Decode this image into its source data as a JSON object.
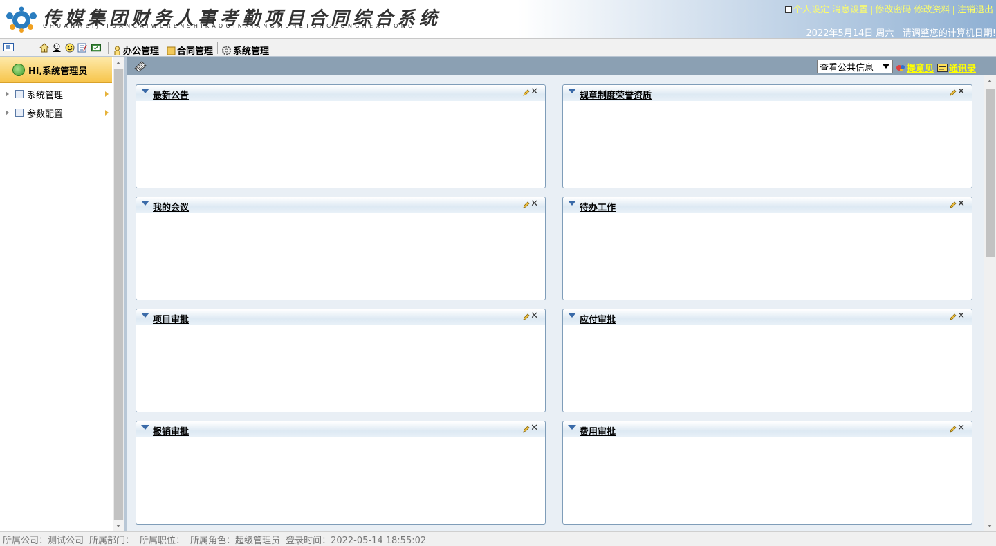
{
  "header": {
    "title": "传媒集团财务人事考勤项目合同综合系统",
    "pinyin": "CHUANMEIJITUANCAIWURENSHIKAOQINXIANGMUHETONGZONGHEXITONG",
    "links": {
      "personal_settings": "个人设定",
      "message_settings": "消息设置",
      "change_password": "修改密码",
      "edit_profile": "修改资料",
      "logout": "注销退出"
    },
    "date_text": "2022年5月14日 周六",
    "notice_text": "请调整您的计算机日期!"
  },
  "toolbar": {
    "menus": [
      {
        "label": "办公管理",
        "icon": "person-icon"
      },
      {
        "label": "合同管理",
        "icon": "folder-icon"
      },
      {
        "label": "系统管理",
        "icon": "gear-icon"
      }
    ]
  },
  "sidebar": {
    "greeting": "Hi,系统管理员",
    "items": [
      {
        "label": "系统管理"
      },
      {
        "label": "参数配置"
      }
    ]
  },
  "main": {
    "select_value": "查看公共信息",
    "feedback_link": "提意见",
    "contacts_link": "通讯录",
    "panels": [
      {
        "title": "最新公告"
      },
      {
        "title": "规章制度荣誉资质"
      },
      {
        "title": "我的会议"
      },
      {
        "title": "待办工作"
      },
      {
        "title": "项目审批"
      },
      {
        "title": "应付审批"
      },
      {
        "title": "报销审批"
      },
      {
        "title": "费用审批"
      }
    ]
  },
  "status": {
    "company": "所属公司：测试公司",
    "department": "所属部门：",
    "position": "所属职位：",
    "role": "所属角色：超级管理员",
    "login_time": "登录时间：2022-05-14 18:55:02"
  },
  "colors": {
    "header_link": "#ffff66",
    "main_bar": "#8ba0b3",
    "panel_border": "#7f9db9",
    "sidebar_greeting_bg": "#f7c44a"
  }
}
